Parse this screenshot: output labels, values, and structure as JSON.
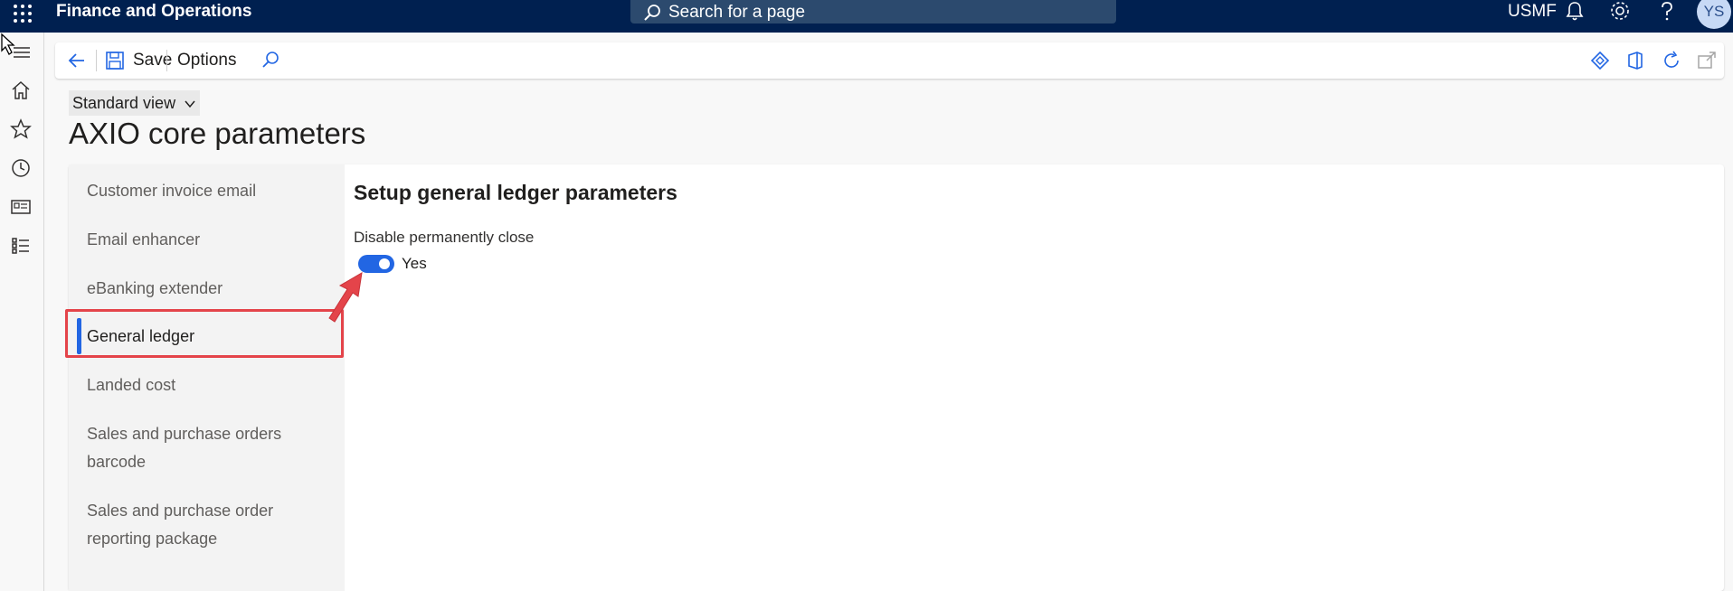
{
  "topbar": {
    "app_title": "Finance and Operations",
    "search_placeholder": "Search for a page",
    "company": "USMF",
    "user_initials": "YS"
  },
  "actionpane": {
    "save_label": "Save",
    "options_label": "Options"
  },
  "page": {
    "view_label": "Standard view",
    "title": "AXIO core parameters"
  },
  "nav": {
    "items": [
      {
        "label": "Customer invoice email"
      },
      {
        "label": "Email enhancer"
      },
      {
        "label": "eBanking extender"
      },
      {
        "label": "General ledger",
        "selected": true
      },
      {
        "label": "Landed cost"
      },
      {
        "label": "Sales and purchase orders barcode"
      },
      {
        "label": "Sales and purchase order reporting package"
      }
    ]
  },
  "content": {
    "section_title": "Setup general ledger parameters",
    "field_label": "Disable permanently close",
    "toggle_value": "Yes",
    "toggle_on": true
  },
  "colors": {
    "topbar_bg": "#002050",
    "accent": "#2266e3",
    "highlight_red": "#e4444a"
  },
  "icons": [
    "waffle-icon",
    "search-icon",
    "bell-icon",
    "gear-icon",
    "help-icon",
    "hamburger-icon",
    "home-icon",
    "star-icon",
    "clock-icon",
    "workspace-icon",
    "list-icon",
    "back-arrow-icon",
    "save-icon",
    "search-icon",
    "diamond-icon",
    "office-icon",
    "refresh-icon",
    "popout-icon"
  ]
}
